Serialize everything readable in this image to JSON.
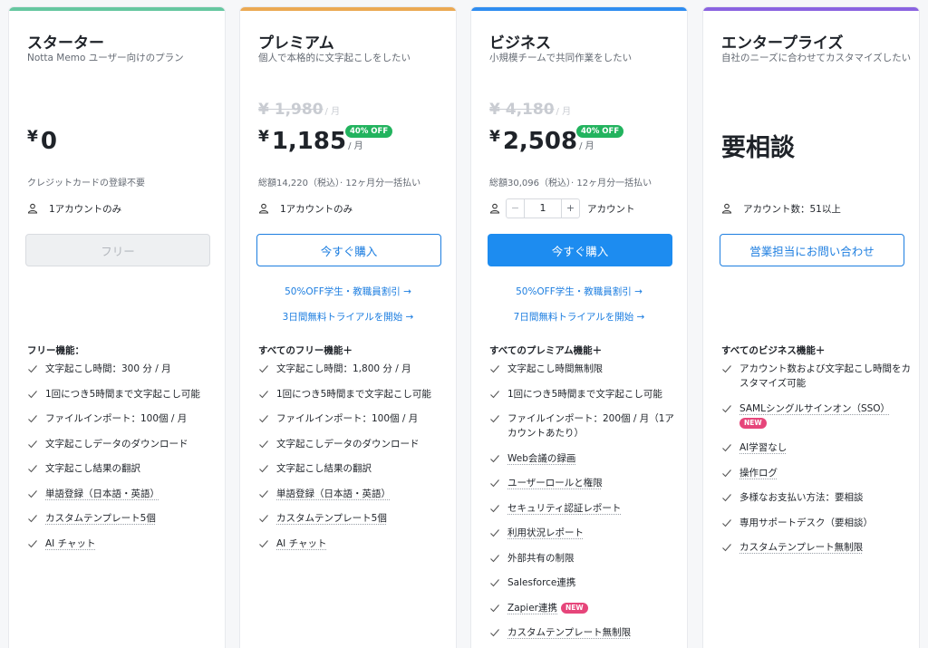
{
  "colors": {
    "starter": "#66c7a0",
    "premium": "#eba953",
    "business": "#2e8cf0",
    "enterprise": "#8a63e0"
  },
  "plans": [
    {
      "title": "スターター",
      "subtitle": "Notta Memo ユーザー向けのプラン",
      "yen": "¥",
      "price": "0",
      "note": "クレジットカードの登録不要",
      "account": "1アカウントのみ",
      "button": "フリー",
      "features_heading": "フリー機能：",
      "features": [
        "文字起こし時間：300 分 / 月",
        "1回につき5時間まで文字起こし可能",
        "ファイルインポート：100個 / 月",
        "文字起こしデータのダウンロード",
        "文字起こし結果の翻訳",
        "単語登録（日本語・英語）",
        "カスタムテンプレート5個",
        "AI チャット"
      ]
    },
    {
      "title": "プレミアム",
      "subtitle": "個人で本格的に文字起こしをしたい",
      "original_price": "¥ 1,980",
      "per": "/ 月",
      "yen": "¥",
      "price": "1,185",
      "badge": "40% OFF",
      "note": "総額14,220（税込）· 12ヶ月分一括払い",
      "account": "1アカウントのみ",
      "button": "今すぐ購入",
      "link1": "50%OFF学生・教職員割引 →",
      "link2": "3日間無料トライアルを開始 →",
      "features_heading": "すべてのフリー機能＋",
      "features": [
        "文字起こし時間：1,800 分 / 月",
        "1回につき5時間まで文字起こし可能",
        "ファイルインポート：100個 / 月",
        "文字起こしデータのダウンロード",
        "文字起こし結果の翻訳",
        "単語登録（日本語・英語）",
        "カスタムテンプレート5個",
        "AI チャット"
      ]
    },
    {
      "title": "ビジネス",
      "subtitle": "小規模チームで共同作業をしたい",
      "original_price": "¥ 4,180",
      "per": "/ 月",
      "yen": "¥",
      "price": "2,508",
      "badge": "40% OFF",
      "note": "総額30,096（税込）· 12ヶ月分一括払い",
      "quantity": "1",
      "minus": "−",
      "plus": "+",
      "account": "アカウント",
      "button": "今すぐ購入",
      "link1": "50%OFF学生・教職員割引 →",
      "link2": "7日間無料トライアルを開始 →",
      "features_heading": "すべてのプレミアム機能＋",
      "features": [
        "文字起こし時間無制限",
        "1回につき5時間まで文字起こし可能",
        "ファイルインポート：200個 / 月（1アカウントあたり）",
        "Web会議の録画",
        "ユーザーロールと権限",
        "セキュリティ認証レポート",
        "利用状況レポート",
        "外部共有の制限",
        "Salesforce連携",
        "Zapier連携",
        "カスタムテンプレート無制限"
      ],
      "new_label": "NEW"
    },
    {
      "title": "エンタープライズ",
      "subtitle": "自社のニーズに合わせてカスタマイズしたい",
      "price": "要相談",
      "account": "アカウント数：51以上",
      "button": "営業担当にお問い合わせ",
      "features_heading": "すべてのビジネス機能＋",
      "features": [
        "アカウント数および文字起こし時間をカスタマイズ可能",
        "SAMLシングルサインオン（SSO）",
        "AI学習なし",
        "操作ログ",
        "多様なお支払い方法：要相談",
        "専用サポートデスク（要相談）",
        "カスタムテンプレート無制限"
      ],
      "new_label": "NEW"
    }
  ]
}
